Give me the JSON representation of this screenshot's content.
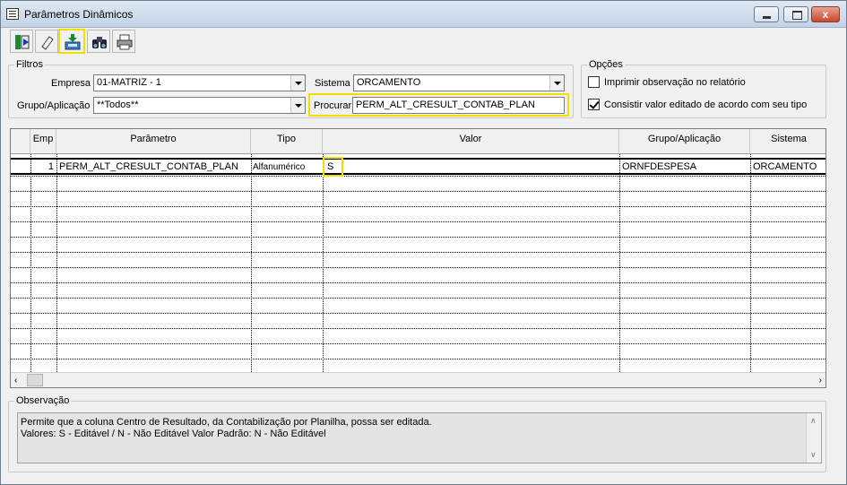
{
  "window": {
    "title": "Parâmetros Dinâmicos",
    "close_label": "x"
  },
  "toolbar": {
    "buttons": [
      {
        "name": "exit-icon"
      },
      {
        "name": "eraser-icon"
      },
      {
        "name": "import-icon"
      },
      {
        "name": "binoculars-icon"
      },
      {
        "name": "printer-icon"
      }
    ]
  },
  "filters": {
    "legend": "Filtros",
    "empresa_label": "Empresa",
    "empresa_value": "01-MATRIZ - 1",
    "sistema_label": "Sistema",
    "sistema_value": "ORCAMENTO",
    "grupo_label": "Grupo/Aplicação",
    "grupo_value": "**Todos**",
    "procurar_label": "Procurar",
    "procurar_value": "PERM_ALT_CRESULT_CONTAB_PLAN"
  },
  "options": {
    "legend": "Opções",
    "opt1_label": "Imprimir observação no relatório",
    "opt1_checked": false,
    "opt2_label": "Consistir valor editado de acordo com seu tipo",
    "opt2_checked": true
  },
  "grid": {
    "headers": {
      "emp": "Emp",
      "parametro": "Parâmetro",
      "tipo": "Tipo",
      "valor": "Valor",
      "grupo": "Grupo/Aplicação",
      "sistema": "Sistema"
    },
    "rows": [
      {
        "emp": "1",
        "parametro": "PERM_ALT_CRESULT_CONTAB_PLAN",
        "tipo": "Alfanumérico",
        "valor": "S",
        "grupo": "ORNFDESPESA",
        "sistema": "ORCAMENTO"
      }
    ]
  },
  "observacao": {
    "legend": "Observação",
    "line1": "Permite que a coluna Centro de Resultado, da Contabilização por Planilha, possa ser editada.",
    "line2": "Valores: S - Editável / N - Não Editável Valor Padrão: N - Não Editável"
  },
  "colors": {
    "highlight": "#f0e000",
    "titlebar": "#c3d3e6"
  }
}
